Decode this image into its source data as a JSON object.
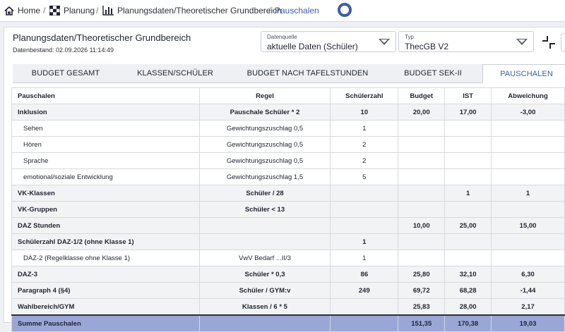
{
  "breadcrumb": {
    "home": "Home",
    "planung": "Planung",
    "planungsdaten": "Planungsdaten/Theoretischer Grundbereich",
    "current": "Pauschalen"
  },
  "header": {
    "title": "Planungsdaten/Theoretischer Grundbereich",
    "datenbestand": "Datenbestand: 02.09.2026 11:14:49"
  },
  "selects": {
    "datenquelle": {
      "label": "Datenquelle",
      "value": "aktuelle Daten (Schüler)"
    },
    "typ": {
      "label": "Typ",
      "value": "ThecGB V2"
    }
  },
  "tabs": [
    "BUDGET GESAMT",
    "KLASSEN/SCHÜLER",
    "BUDGET NACH TAFELSTUNDEN",
    "BUDGET SEK-II",
    "PAUSCHALEN"
  ],
  "table": {
    "headers": [
      "Pauschalen",
      "Regel",
      "Schülerzahl",
      "Budget",
      "IST",
      "Abweichung"
    ],
    "rows": [
      {
        "cells": [
          "Inklusion",
          "Pauschale Schüler * 2",
          "10",
          "20,00",
          "17,00",
          "-3,00"
        ],
        "style": "grey bold"
      },
      {
        "cells": [
          "Sehen",
          "Gewichtungszuschlag 0,5",
          "1",
          "",
          "",
          ""
        ],
        "style": "white sub"
      },
      {
        "cells": [
          "Hören",
          "Gewichtungszuschlag 0,5",
          "2",
          "",
          "",
          ""
        ],
        "style": "white sub"
      },
      {
        "cells": [
          "Sprache",
          "Gewichtungszuschlag 0,5",
          "2",
          "",
          "",
          ""
        ],
        "style": "white sub"
      },
      {
        "cells": [
          "emotional/soziale Entwicklung",
          "Gewichtungszuschlag 1,5",
          "5",
          "",
          "",
          ""
        ],
        "style": "white sub"
      },
      {
        "cells": [
          "VK-Klassen",
          "Schüler / 28",
          "",
          "",
          "1",
          "1"
        ],
        "style": "grey bold"
      },
      {
        "cells": [
          "VK-Gruppen",
          "Schüler < 13",
          "",
          "",
          "",
          ""
        ],
        "style": "grey bold"
      },
      {
        "cells": [
          "DAZ Stunden",
          "",
          "",
          "10,00",
          "25,00",
          "15,00"
        ],
        "style": "grey bold"
      },
      {
        "cells": [
          "Schülerzahl DAZ-1/2 (ohne Klasse 1)",
          "",
          "1",
          "",
          "",
          ""
        ],
        "style": "grey bold"
      },
      {
        "cells": [
          "DAZ-2 (Regelklasse ohne Klasse 1)",
          "VwV Bedarf ...II/3",
          "1",
          "",
          "",
          ""
        ],
        "style": "white sub"
      },
      {
        "cells": [
          "DAZ-3",
          "Schüler * 0,3",
          "86",
          "25,80",
          "32,10",
          "6,30"
        ],
        "style": "grey bold"
      },
      {
        "cells": [
          "Paragraph 4 (§4)",
          "Schüler / GYM:v",
          "249",
          "69,72",
          "68,28",
          "-1,44"
        ],
        "style": "grey bold"
      },
      {
        "cells": [
          "Wahlbereich/GYM",
          "Klassen / 6 * 5",
          "",
          "25,83",
          "28,00",
          "2,17"
        ],
        "style": "grey bold"
      },
      {
        "cells": [
          "Summe Pauschalen",
          "",
          "",
          "151,35",
          "170,38",
          "19,03"
        ],
        "style": "sum"
      }
    ]
  },
  "colors": {
    "accent": "#3d5ea8",
    "sum_row": "#9aa7d6"
  }
}
